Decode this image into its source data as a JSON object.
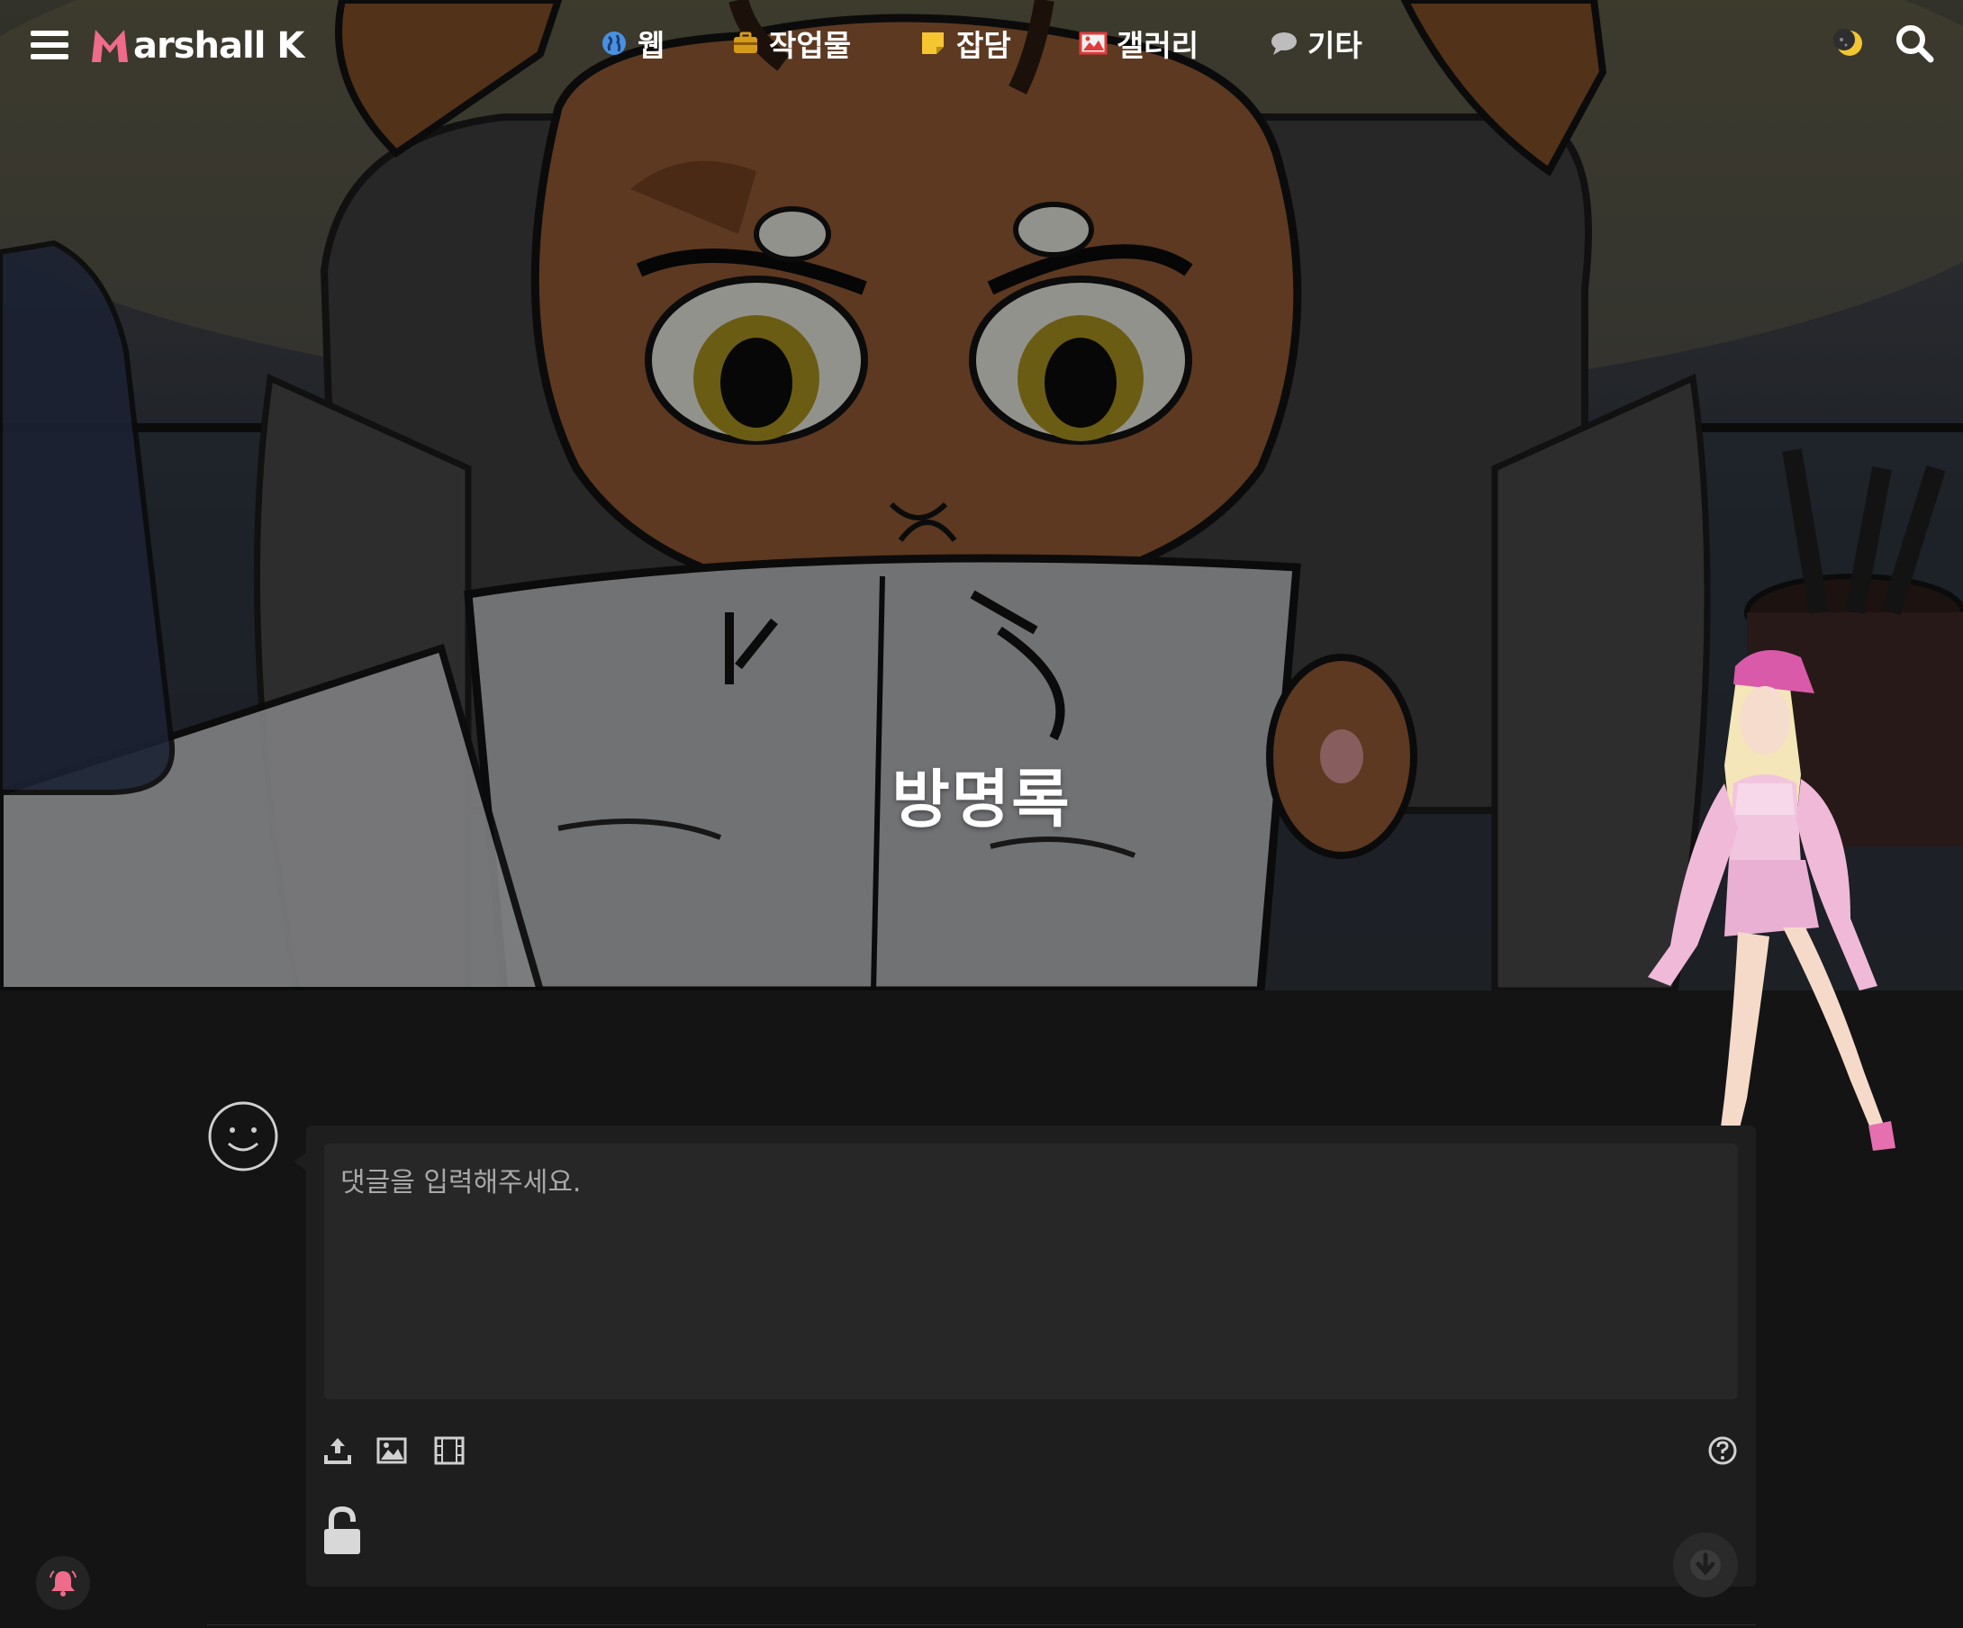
{
  "site": {
    "logo_text": "arshall K",
    "logo_letter": "M"
  },
  "nav": {
    "items": [
      {
        "label": "웹",
        "icon": "globe-icon"
      },
      {
        "label": "작업물",
        "icon": "briefcase-icon"
      },
      {
        "label": "잡담",
        "icon": "sticky-note-icon"
      },
      {
        "label": "갤러리",
        "icon": "image-icon"
      },
      {
        "label": "기타",
        "icon": "speech-bubble-icon"
      }
    ]
  },
  "hero": {
    "title": "방명록"
  },
  "comment_form": {
    "placeholder": "댓글을 입력해주세요.",
    "tools": [
      "upload-icon",
      "image-icon",
      "film-icon"
    ],
    "help_icon": "question-circle-icon",
    "lock_icon": "unlock-icon",
    "submit_icon": "arrow-down-icon"
  },
  "notification": {
    "icon": "bell-icon"
  },
  "colors": {
    "accent_pink": "#ef6b8a",
    "bg": "#141414",
    "form_bg": "#1e1e1e",
    "input_bg": "#272727"
  }
}
